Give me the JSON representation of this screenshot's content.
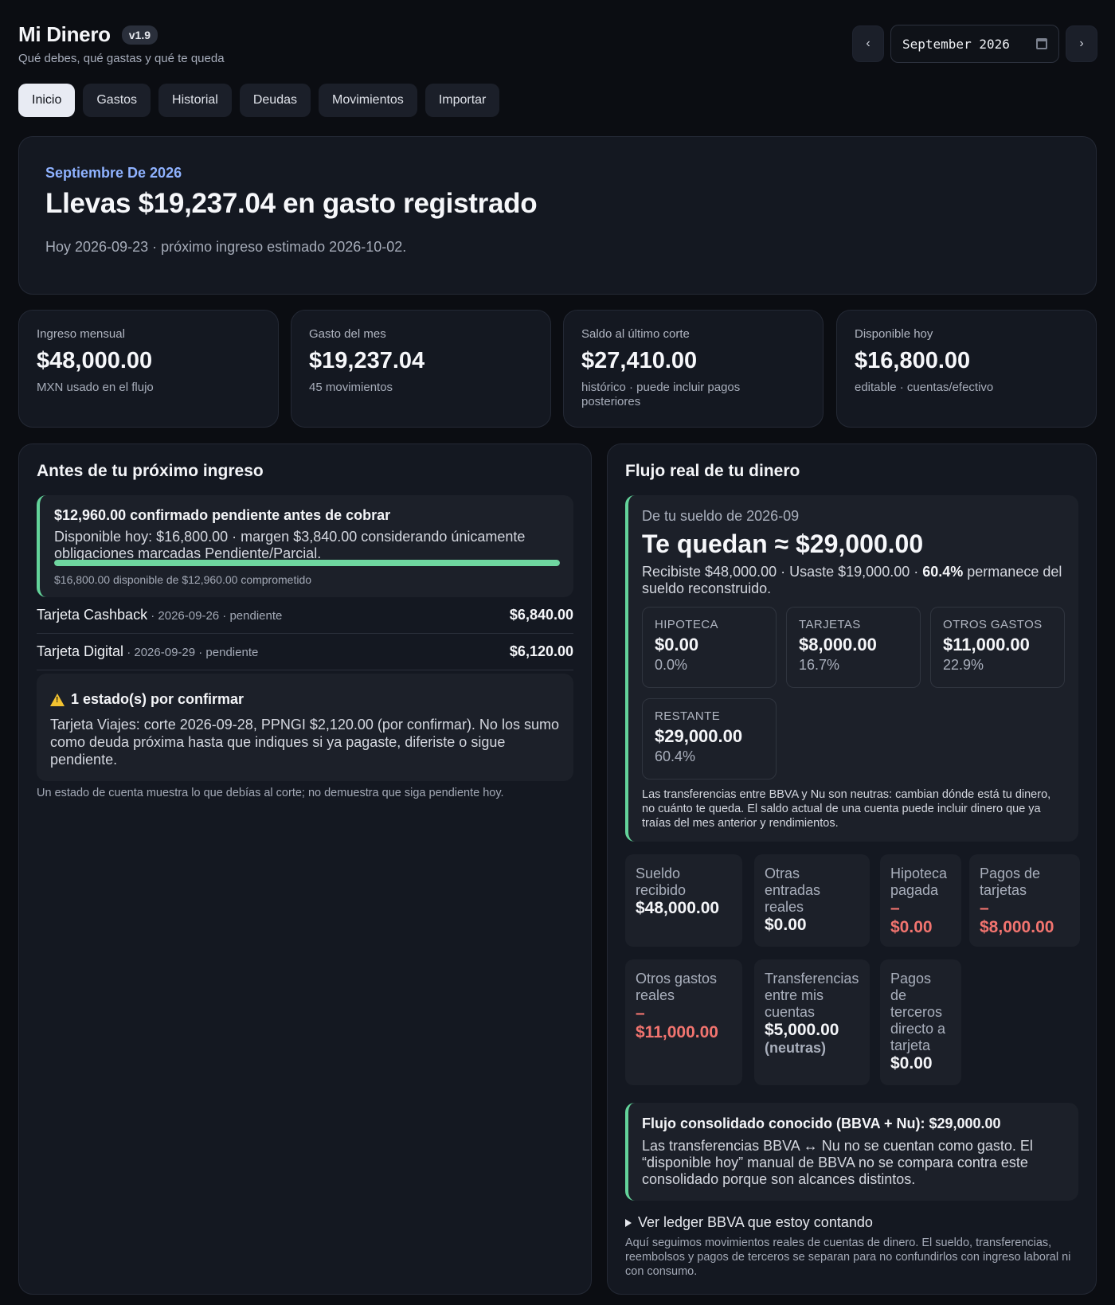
{
  "app": {
    "title": "Mi Dinero",
    "version": "v1.9",
    "subtitle": "Qué debes, qué gastas y qué te queda"
  },
  "month_nav": {
    "prev": "‹",
    "next": "›",
    "value": "September 2026"
  },
  "tabs": [
    "Inicio",
    "Gastos",
    "Historial",
    "Deudas",
    "Movimientos",
    "Importar"
  ],
  "hero": {
    "kicker": "Septiembre De 2026",
    "title": "Llevas $19,237.04 en gasto registrado",
    "sub": "Hoy 2026-09-23 · próximo ingreso estimado 2026-10-02."
  },
  "stats": [
    {
      "label": "Ingreso mensual",
      "value": "$48,000.00",
      "note": "MXN usado en el flujo"
    },
    {
      "label": "Gasto del mes",
      "value": "$19,237.04",
      "note": "45 movimientos"
    },
    {
      "label": "Saldo al último corte",
      "value": "$27,410.00",
      "note": "histórico · puede incluir pagos posteriores"
    },
    {
      "label": "Disponible hoy",
      "value": "$16,800.00",
      "note": "editable · cuentas/efectivo"
    }
  ],
  "before_income": {
    "title": "Antes de tu próximo ingreso",
    "pending_title": "$12,960.00 confirmado pendiente antes de cobrar",
    "pending_text": "Disponible hoy: $16,800.00 · margen $3,840.00 considerando únicamente obligaciones marcadas Pendiente/Parcial.",
    "progress": 1.0,
    "progress_caption": "$16,800.00 disponible de $12,960.00 comprometido",
    "debts": [
      {
        "name": "Tarjeta Cashback",
        "meta": " · 2026-09-26 · pendiente",
        "amount": "$6,840.00"
      },
      {
        "name": "Tarjeta Digital",
        "meta": " · 2026-09-29 · pendiente",
        "amount": "$6,120.00"
      }
    ],
    "warning_title": "1 estado(s) por confirmar",
    "warning_text": "Tarjeta Viajes: corte 2026-09-28, PPNGI $2,120.00 (por confirmar). No los sumo como deuda próxima hasta que indiques si ya pagaste, diferiste o sigue pendiente.",
    "footnote": "Un estado de cuenta muestra lo que debías al corte; no demuestra que siga pendiente hoy."
  },
  "flow": {
    "title": "Flujo real de tu dinero",
    "kicker": "De tu sueldo de 2026-09",
    "big": "Te quedan ≈ $29,000.00",
    "desc_a": "Recibiste $48,000.00 · Usaste $19,000.00 · ",
    "desc_pct": "60.4%",
    "desc_b": " permanece del sueldo reconstruido.",
    "breakdown": [
      {
        "label": "HIPOTECA",
        "value": "$0.00",
        "pct": "0.0%"
      },
      {
        "label": "TARJETAS",
        "value": "$8,000.00",
        "pct": "16.7%"
      },
      {
        "label": "OTROS GASTOS",
        "value": "$11,000.00",
        "pct": "22.9%"
      },
      {
        "label": "RESTANTE",
        "value": "$29,000.00",
        "pct": "60.4%"
      }
    ],
    "note": "Las transferencias entre BBVA y Nu son neutras: cambian dónde está tu dinero, no cuánto te queda. El saldo actual de una cuenta puede incluir dinero que ya traías del mes anterior y rendimientos.",
    "tiles": [
      {
        "label": "Sueldo recibido",
        "value": "$48,000.00",
        "sign": "",
        "extra": ""
      },
      {
        "label": "Otras entradas reales",
        "value": "$0.00",
        "sign": "",
        "extra": ""
      },
      {
        "label": "Hipoteca pagada",
        "value": "$0.00",
        "sign": "–",
        "extra": ""
      },
      {
        "label": "Pagos de tarjetas",
        "value": "$8,000.00",
        "sign": "–",
        "extra": ""
      },
      {
        "label": "Otros gastos reales",
        "value": "$11,000.00",
        "sign": "–",
        "extra": ""
      },
      {
        "label": "Transferencias entre mis cuentas",
        "value": "$5,000.00",
        "sign": "",
        "extra": "(neutras)"
      },
      {
        "label": "Pagos de terceros directo a tarjeta",
        "value": "$0.00",
        "sign": "",
        "extra": ""
      }
    ],
    "consol_title": "Flujo consolidado conocido (BBVA + Nu): $29,000.00",
    "consol_text": "Las transferencias BBVA ↔ Nu no se cuentan como gasto. El “disponible hoy” manual de BBVA no se compara contra este consolidado porque son alcances distintos.",
    "ledger_toggle": "Ver ledger BBVA que estoy contando",
    "ledger_note": "Aquí seguimos movimientos reales de cuentas de dinero. El sueldo, transferencias, reembolsos y pagos de terceros se separan para no confundirlos con ingreso laboral ni con consumo."
  }
}
